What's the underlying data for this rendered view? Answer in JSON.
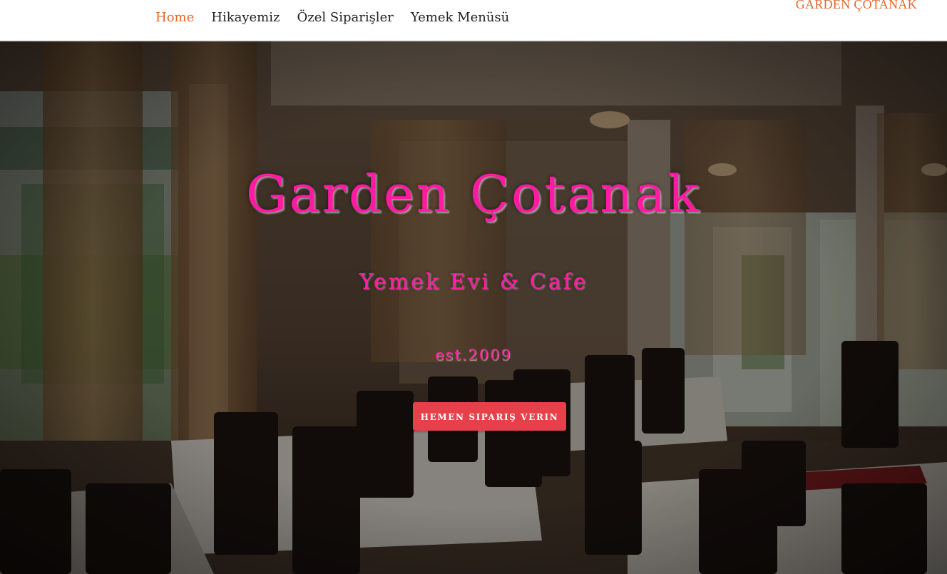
{
  "nav": {
    "items": [
      {
        "label": "Home",
        "active": true
      },
      {
        "label": "Hikayemiz",
        "active": false
      },
      {
        "label": "Özel Siparişler",
        "active": false
      },
      {
        "label": "Yemek Menüsü",
        "active": false
      }
    ],
    "brand": "GARDEN ÇOTANAK"
  },
  "hero": {
    "title": "Garden Çotanak",
    "subtitle": "Yemek Evi & Cafe",
    "est": "est.2009",
    "cta_label": "HEMEN SIPARIŞ VERIN",
    "background_image": "restaurant-interior-photo"
  },
  "colors": {
    "accent_orange": "#e8662a",
    "title_pink": "#ff1aa3",
    "cta_red": "#e8404a"
  }
}
